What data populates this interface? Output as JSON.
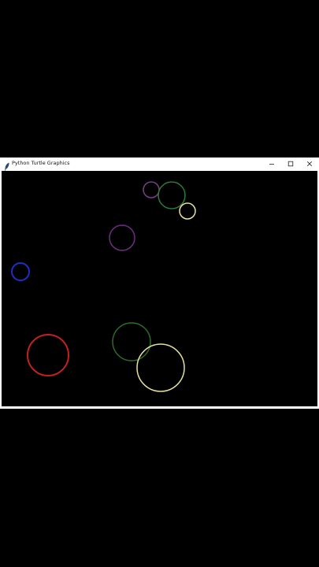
{
  "window": {
    "title": "Python Turtle Graphics",
    "icon": "feather-icon",
    "controls": [
      "minimize-icon",
      "maximize-icon",
      "close-icon"
    ]
  },
  "canvas": {
    "background": "#000000",
    "circles": [
      {
        "name": "circle-purple-small",
        "color": "#7a3f86"
      },
      {
        "name": "circle-green-top",
        "color": "#2f7a3a"
      },
      {
        "name": "circle-yellow-small",
        "color": "#e8e39a"
      },
      {
        "name": "circle-purple-mid",
        "color": "#6b2f80"
      },
      {
        "name": "circle-blue",
        "color": "#1f2fc4"
      },
      {
        "name": "circle-green-bottom",
        "color": "#2f6b2a"
      },
      {
        "name": "circle-red",
        "color": "#c0221e"
      },
      {
        "name": "circle-yellow-large",
        "color": "#e4e1a0"
      }
    ]
  }
}
